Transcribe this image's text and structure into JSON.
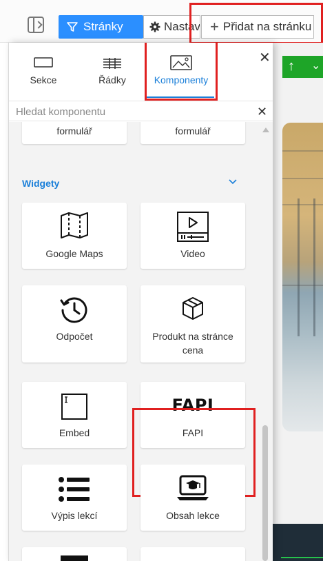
{
  "toolbar": {
    "pages_label": "Stránky",
    "settings_label": "Nastavení",
    "add_label": "Přidat na stránku"
  },
  "panel": {
    "tabs": [
      {
        "label": "Sekce",
        "icon": "section-icon"
      },
      {
        "label": "Řádky",
        "icon": "rows-icon"
      },
      {
        "label": "Komponenty",
        "icon": "image-icon",
        "active": true
      }
    ],
    "search_placeholder": "Hledat komponentu",
    "top_cards": [
      "formulář",
      "formulář"
    ],
    "section_title": "Widgety",
    "cards": [
      {
        "label": "Google Maps",
        "icon": "map-icon"
      },
      {
        "label": "Video",
        "icon": "video-icon"
      },
      {
        "label": "Odpočet",
        "icon": "countdown-icon"
      },
      {
        "label": "Produkt na stránce cena",
        "icon": "product-box-icon"
      },
      {
        "label": "Embed",
        "icon": "embed-icon"
      },
      {
        "label": "FAPI",
        "icon": "fapi-logo",
        "logo_text": "FAPI"
      },
      {
        "label": "Výpis lekcí",
        "icon": "lesson-list-icon"
      },
      {
        "label": "Obsah lekce",
        "icon": "lesson-content-icon"
      }
    ]
  },
  "colors": {
    "accent": "#1a7fd9",
    "primary_button": "#2b8fff",
    "highlight": "#e02020",
    "green_bar": "#1ea528"
  }
}
